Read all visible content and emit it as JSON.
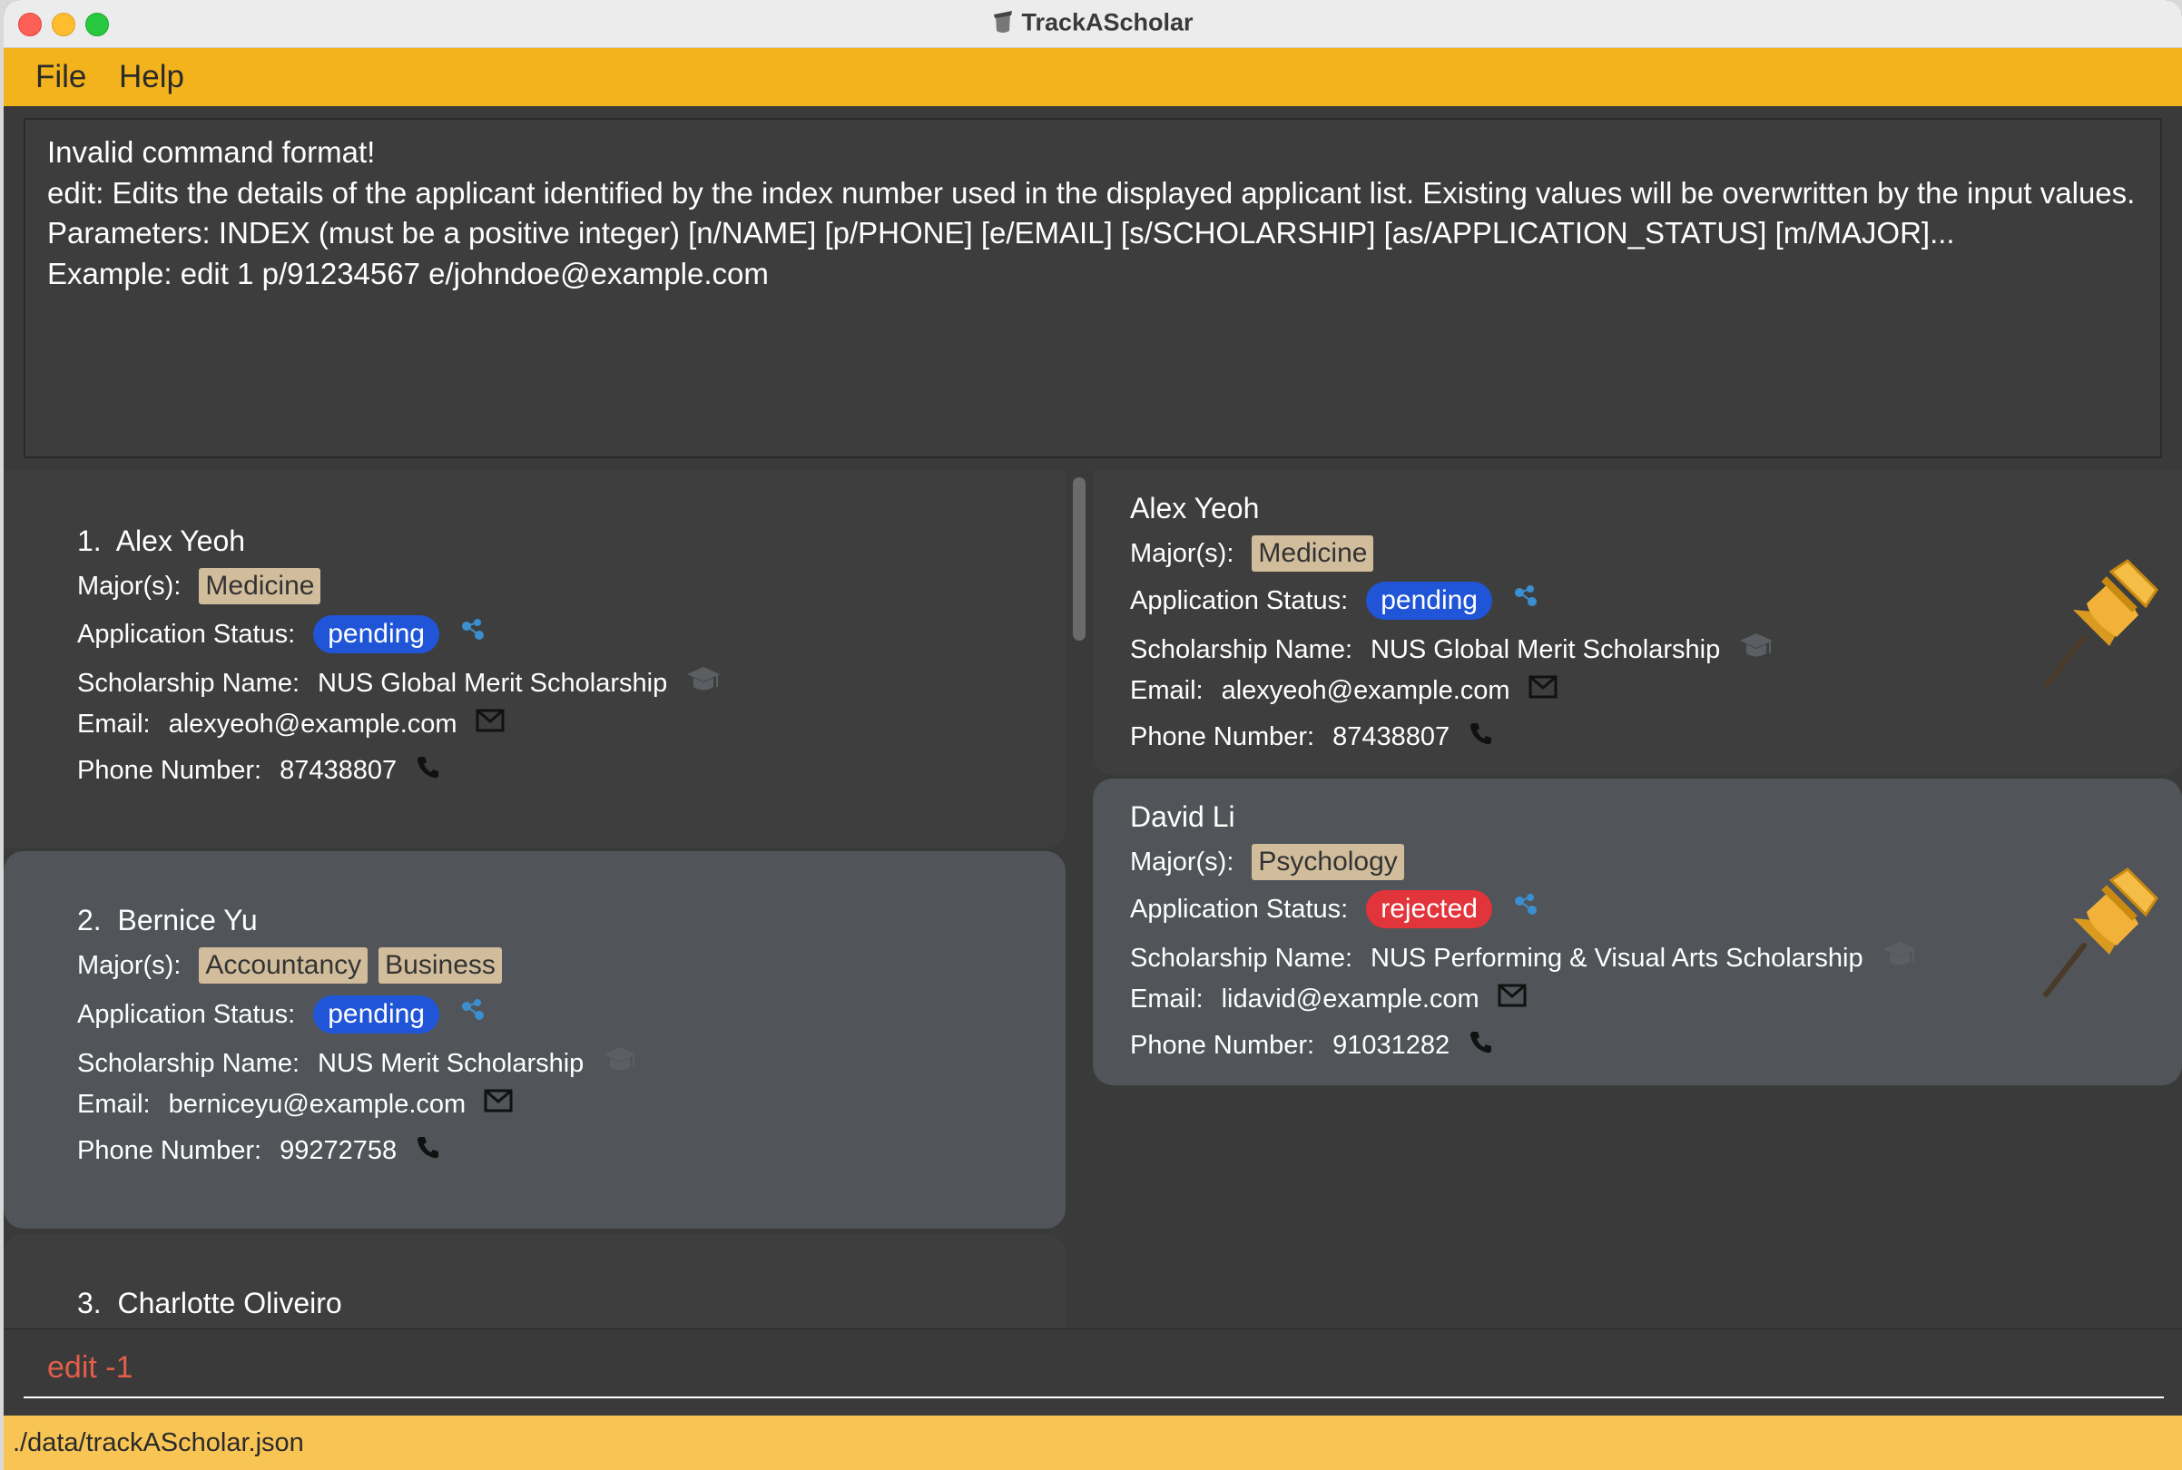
{
  "window": {
    "title": "TrackAScholar"
  },
  "menu": {
    "file": "File",
    "help": "Help"
  },
  "result": {
    "lines": [
      "Invalid command format!",
      "edit: Edits the details of the applicant identified by the index number used in the displayed applicant list. Existing values will be overwritten by the input values.",
      "Parameters: INDEX (must be a positive integer) [n/NAME] [p/PHONE] [e/EMAIL] [s/SCHOLARSHIP] [as/APPLICATION_STATUS] [m/MAJOR]...",
      "Example: edit 1 p/91234567 e/johndoe@example.com"
    ]
  },
  "labels": {
    "major": "Major(s):",
    "status": "Application Status:",
    "scholarship": "Scholarship Name:",
    "email": "Email:",
    "phone": "Phone Number:"
  },
  "applicants": [
    {
      "index": "1.",
      "name": "Alex Yeoh",
      "majors": [
        "Medicine"
      ],
      "status": "pending",
      "scholarship": "NUS Global Merit Scholarship",
      "email": "alexyeoh@example.com",
      "phone": "87438807"
    },
    {
      "index": "2.",
      "name": "Bernice Yu",
      "majors": [
        "Accountancy",
        "Business"
      ],
      "status": "pending",
      "scholarship": "NUS Merit Scholarship",
      "email": "berniceyu@example.com",
      "phone": "99272758"
    },
    {
      "index": "3.",
      "name": "Charlotte Oliveiro"
    }
  ],
  "pinned": [
    {
      "name": "Alex Yeoh",
      "majors": [
        "Medicine"
      ],
      "status": "pending",
      "scholarship": "NUS Global Merit Scholarship",
      "email": "alexyeoh@example.com",
      "phone": "87438807"
    },
    {
      "name": "David Li",
      "majors": [
        "Psychology"
      ],
      "status": "rejected",
      "scholarship": "NUS Performing & Visual Arts Scholarship",
      "email": "lidavid@example.com",
      "phone": "91031282"
    }
  ],
  "command": {
    "value": "edit -1"
  },
  "status_bar": {
    "path": "./data/trackAScholar.json"
  },
  "colors": {
    "menu": "#f3b31c",
    "pending": "#1f55d6",
    "rejected": "#e2343b",
    "tag": "#d1bd9c",
    "status_bar": "#f8c555"
  },
  "icons": [
    "app-icon",
    "status-icon",
    "graduation-cap-icon",
    "mail-icon",
    "phone-icon",
    "pin-icon"
  ]
}
